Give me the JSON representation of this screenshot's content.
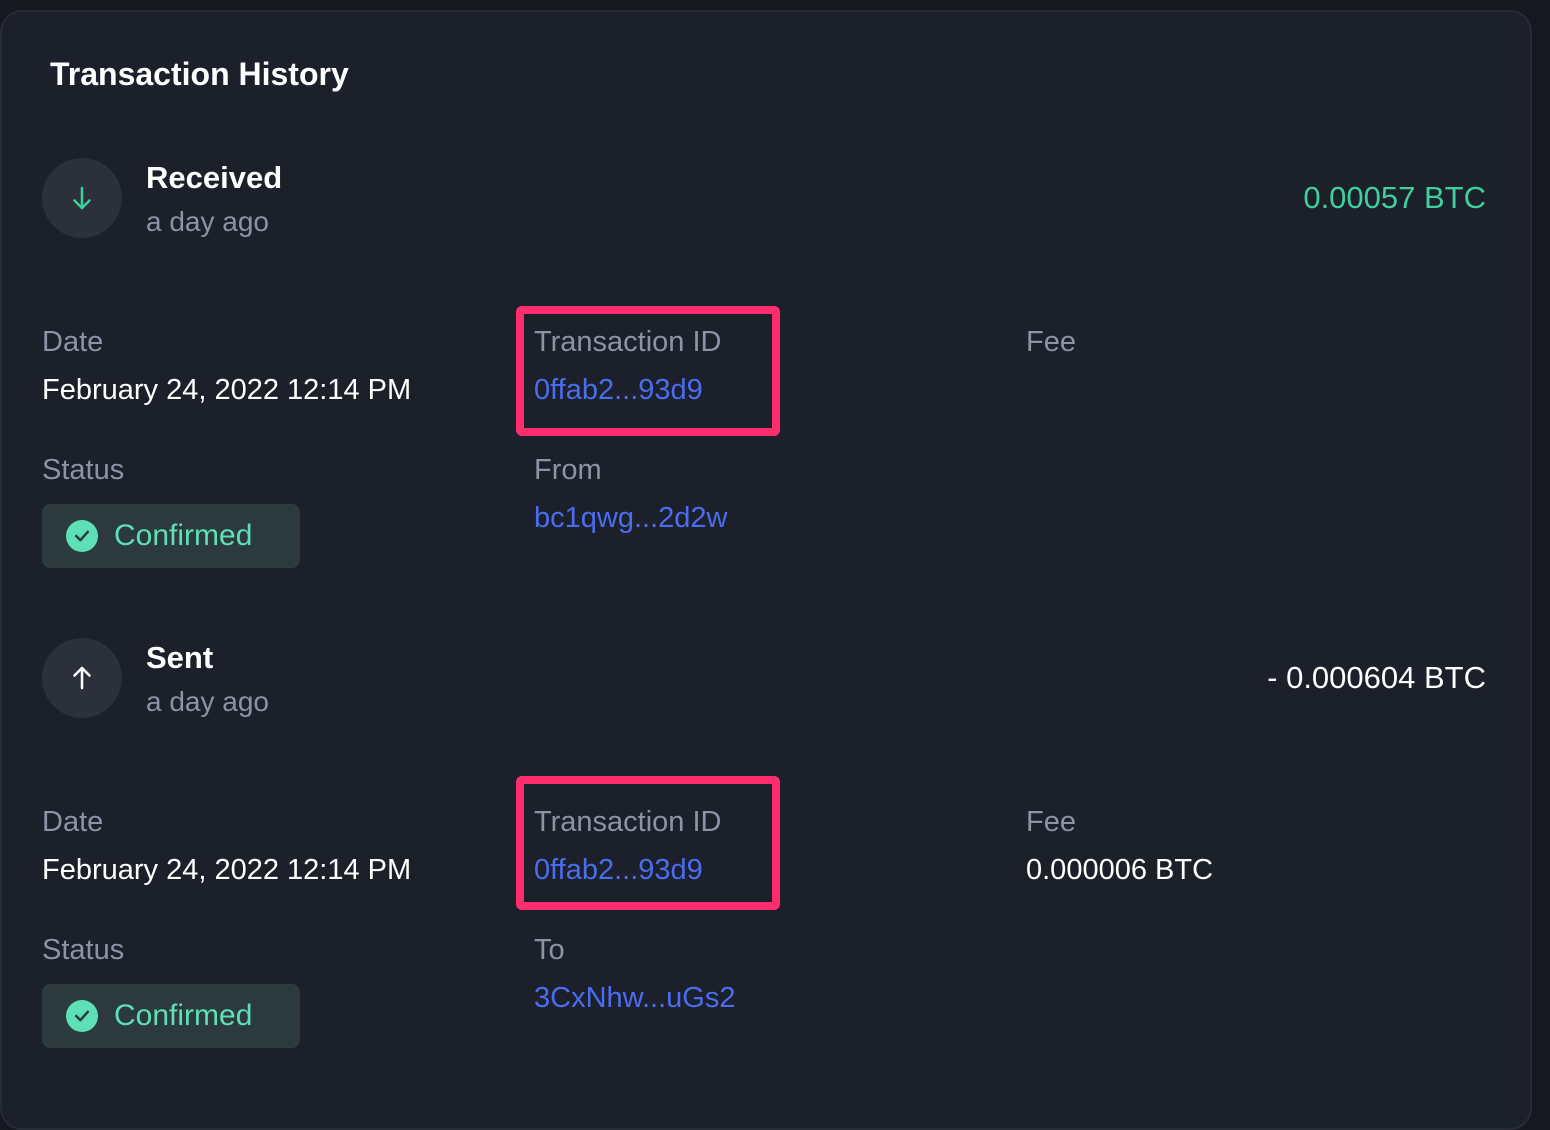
{
  "header": {
    "title": "Transaction History"
  },
  "transactions": [
    {
      "type": "Received",
      "time": "a day ago",
      "amount": "0.00057 BTC",
      "amount_color": "#3fcf9c",
      "icon": "arrow-down-icon",
      "date_label": "Date",
      "date": "February 24, 2022 12:14 PM",
      "txid_label": "Transaction ID",
      "txid": "0ffab2...93d9",
      "fee_label": "Fee",
      "fee": "",
      "status_label": "Status",
      "status": "Confirmed",
      "party_label": "From",
      "party": "bc1qwg...2d2w"
    },
    {
      "type": "Sent",
      "time": "a day ago",
      "amount": "- 0.000604 BTC",
      "amount_color": "#ffffff",
      "icon": "arrow-up-icon",
      "date_label": "Date",
      "date": "February 24, 2022 12:14 PM",
      "txid_label": "Transaction ID",
      "txid": "0ffab2...93d9",
      "fee_label": "Fee",
      "fee": "0.000006 BTC",
      "status_label": "Status",
      "status": "Confirmed",
      "party_label": "To",
      "party": "3CxNhw...uGs2"
    }
  ],
  "colors": {
    "background": "#1c202b",
    "link": "#4a6df0",
    "confirmed": "#5de0b5",
    "highlight": "#ff2d6d"
  }
}
